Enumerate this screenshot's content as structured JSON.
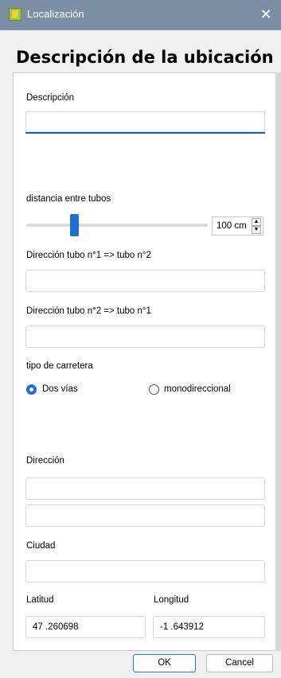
{
  "window": {
    "title": "Localización"
  },
  "heading": "Descripción de la ubicación",
  "descripcion": {
    "label": "Descripción",
    "value": ""
  },
  "distancia": {
    "label": "distancia entre tubos",
    "value": "100 cm",
    "slider_fraction": 0.26
  },
  "dir1": {
    "label": "Dirección tubo n°1 => tubo n°2",
    "value": ""
  },
  "dir2": {
    "label": "Dirección tubo n°2 => tubo n°1",
    "value": ""
  },
  "carretera": {
    "label": "tipo de carretera",
    "options": [
      {
        "label": "Dos vías",
        "selected": true
      },
      {
        "label": "monodireccional",
        "selected": false
      }
    ]
  },
  "direccion": {
    "label": "Dirección",
    "line1": "",
    "line2": ""
  },
  "ciudad": {
    "label": "Ciudad",
    "value": ""
  },
  "latitud": {
    "label": "Latitud",
    "value": "47 .260698"
  },
  "longitud": {
    "label": "Longitud",
    "value": "-1 .643912"
  },
  "buttons": {
    "ok": "OK",
    "cancel": "Cancel"
  },
  "colors": {
    "accent": "#1f6fd1",
    "titlebar": "#7a8ea4"
  }
}
